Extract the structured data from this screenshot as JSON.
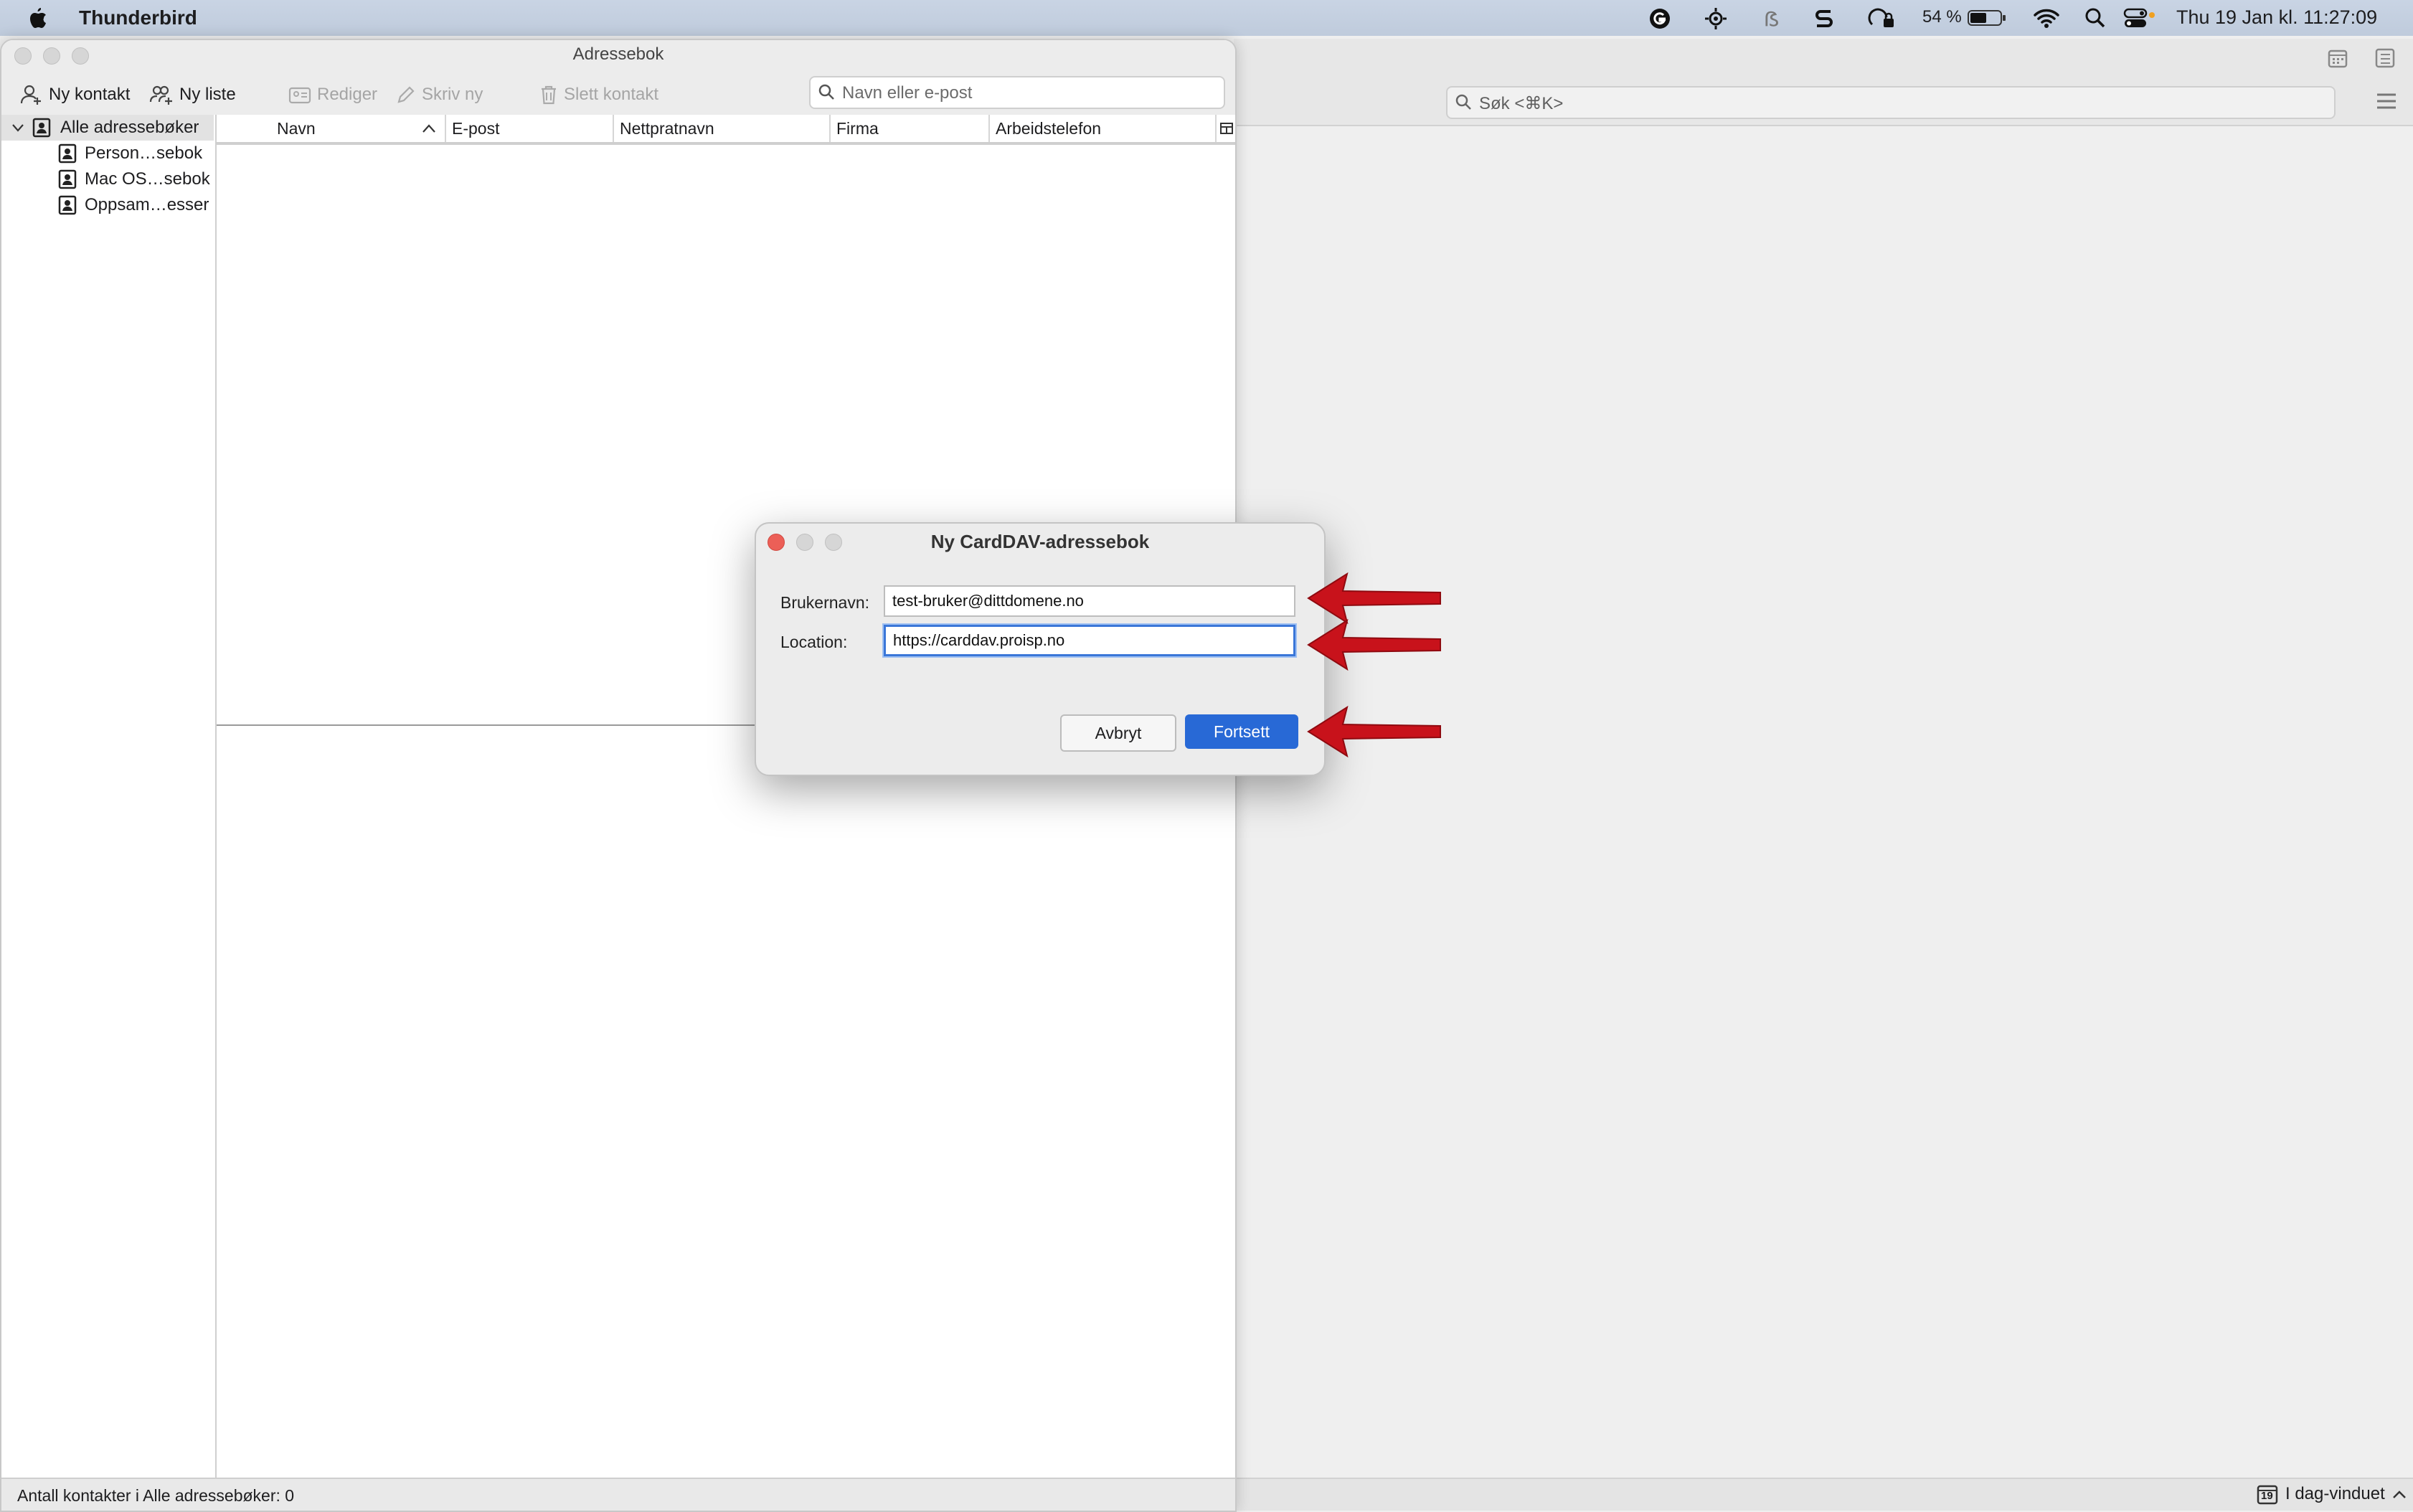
{
  "menubar": {
    "app_name": "Thunderbird",
    "battery_percent": "54 %",
    "clock": "Thu 19 Jan kl. 11:27:09",
    "icons": [
      "apple-icon",
      "grammarly-icon",
      "gear-sun-icon",
      "s-icon",
      "s-logo-icon",
      "vpn-lock-icon",
      "battery-icon",
      "wifi-icon",
      "spotlight-icon",
      "control-center-icon"
    ]
  },
  "main_window": {
    "search_placeholder": "Søk <⌘K>",
    "today_pane_label": "I dag-vinduet",
    "today_day": "19"
  },
  "addressbook": {
    "title": "Adressebok",
    "toolbar": {
      "new_contact": "Ny kontakt",
      "new_list": "Ny liste",
      "edit": "Rediger",
      "write": "Skriv ny",
      "delete": "Slett kontakt"
    },
    "search_placeholder": "Navn eller e-post",
    "tree": {
      "root": "Alle adressebøker",
      "items": [
        "Person…sebok",
        "Mac OS…sebok",
        "Oppsam…esser"
      ]
    },
    "columns": [
      "Navn",
      "E-post",
      "Nettpratnavn",
      "Firma",
      "Arbeidstelefon"
    ],
    "status": "Antall kontakter i Alle adressebøker: 0"
  },
  "dialog": {
    "title": "Ny CardDAV-adressebok",
    "username_label": "Brukernavn:",
    "username_value": "test-bruker@dittdomene.no",
    "location_label": "Location:",
    "location_value": "https://carddav.proisp.no",
    "cancel": "Avbryt",
    "continue": "Fortsett"
  },
  "colors": {
    "accent": "#2869d6",
    "arrow": "#c8121b",
    "close_red": "#ec5f57"
  }
}
